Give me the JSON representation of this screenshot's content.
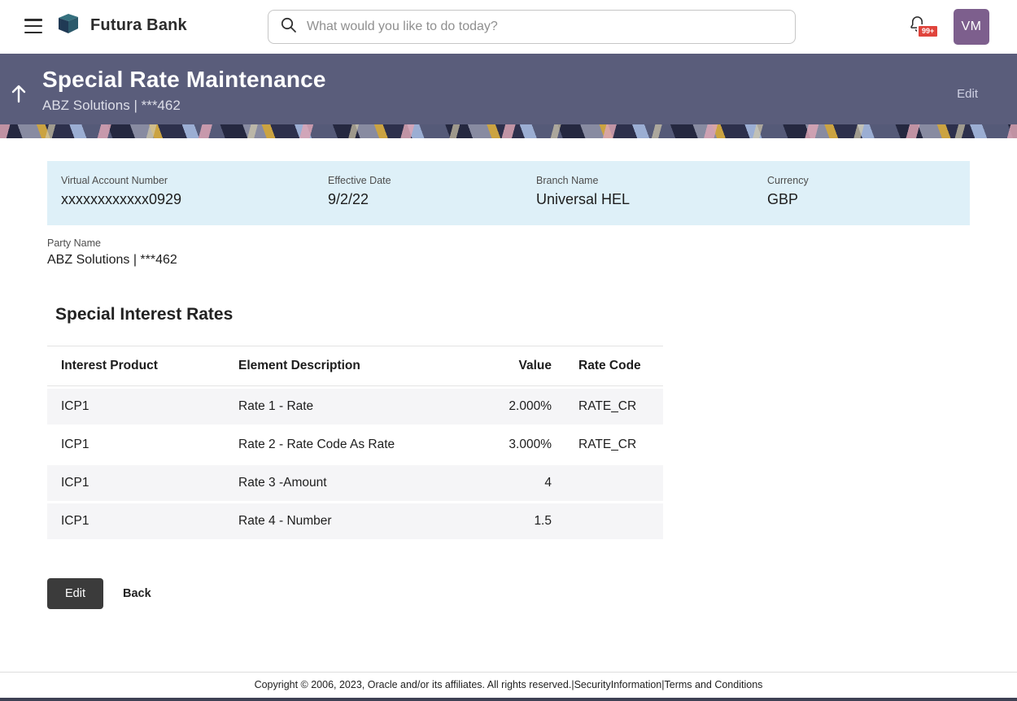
{
  "colors": {
    "banner_background": "#5a5d7b",
    "summary_panel_background": "#def0f8",
    "avatar_background": "#7d5f8d",
    "notification_badge_background": "#e0443c",
    "primary_button_background": "#3b3b3b"
  },
  "header": {
    "brand": "Futura Bank",
    "search_placeholder": "What would you like to do today?",
    "notification_badge": "99+",
    "avatar_initials": "VM"
  },
  "banner": {
    "title": "Special Rate Maintenance",
    "subtitle": "ABZ Solutions | ***462",
    "edit_link": "Edit"
  },
  "summary": {
    "fields": [
      {
        "label": "Virtual Account Number",
        "value": "xxxxxxxxxxxx0929"
      },
      {
        "label": "Effective Date",
        "value": "9/2/22"
      },
      {
        "label": "Branch Name",
        "value": "Universal HEL"
      },
      {
        "label": "Currency",
        "value": "GBP"
      }
    ],
    "party_label": "Party Name",
    "party_value": "ABZ Solutions | ***462"
  },
  "rates": {
    "title": "Special Interest Rates",
    "columns": [
      "Interest Product",
      "Element Description",
      "Value",
      "Rate Code"
    ],
    "rows": [
      {
        "product": "ICP1",
        "description": "Rate 1 - Rate",
        "value": "2.000%",
        "rate_code": "RATE_CR"
      },
      {
        "product": "ICP1",
        "description": "Rate 2 - Rate Code As Rate",
        "value": "3.000%",
        "rate_code": "RATE_CR"
      },
      {
        "product": "ICP1",
        "description": "Rate 3 -Amount",
        "value": "4",
        "rate_code": ""
      },
      {
        "product": "ICP1",
        "description": "Rate 4 - Number",
        "value": "1.5",
        "rate_code": ""
      }
    ]
  },
  "actions": {
    "edit": "Edit",
    "back": "Back"
  },
  "footer": {
    "copyright": "Copyright © 2006, 2023, Oracle and/or its affiliates. All rights reserved.",
    "separator": "|",
    "links": [
      "SecurityInformation",
      "Terms and Conditions"
    ]
  },
  "icons": {
    "menu": "hamburger-menu",
    "search": "magnifier",
    "notifications": "bell",
    "scroll_top": "arrow-up",
    "brand_logo": "futura-bank-logo"
  }
}
